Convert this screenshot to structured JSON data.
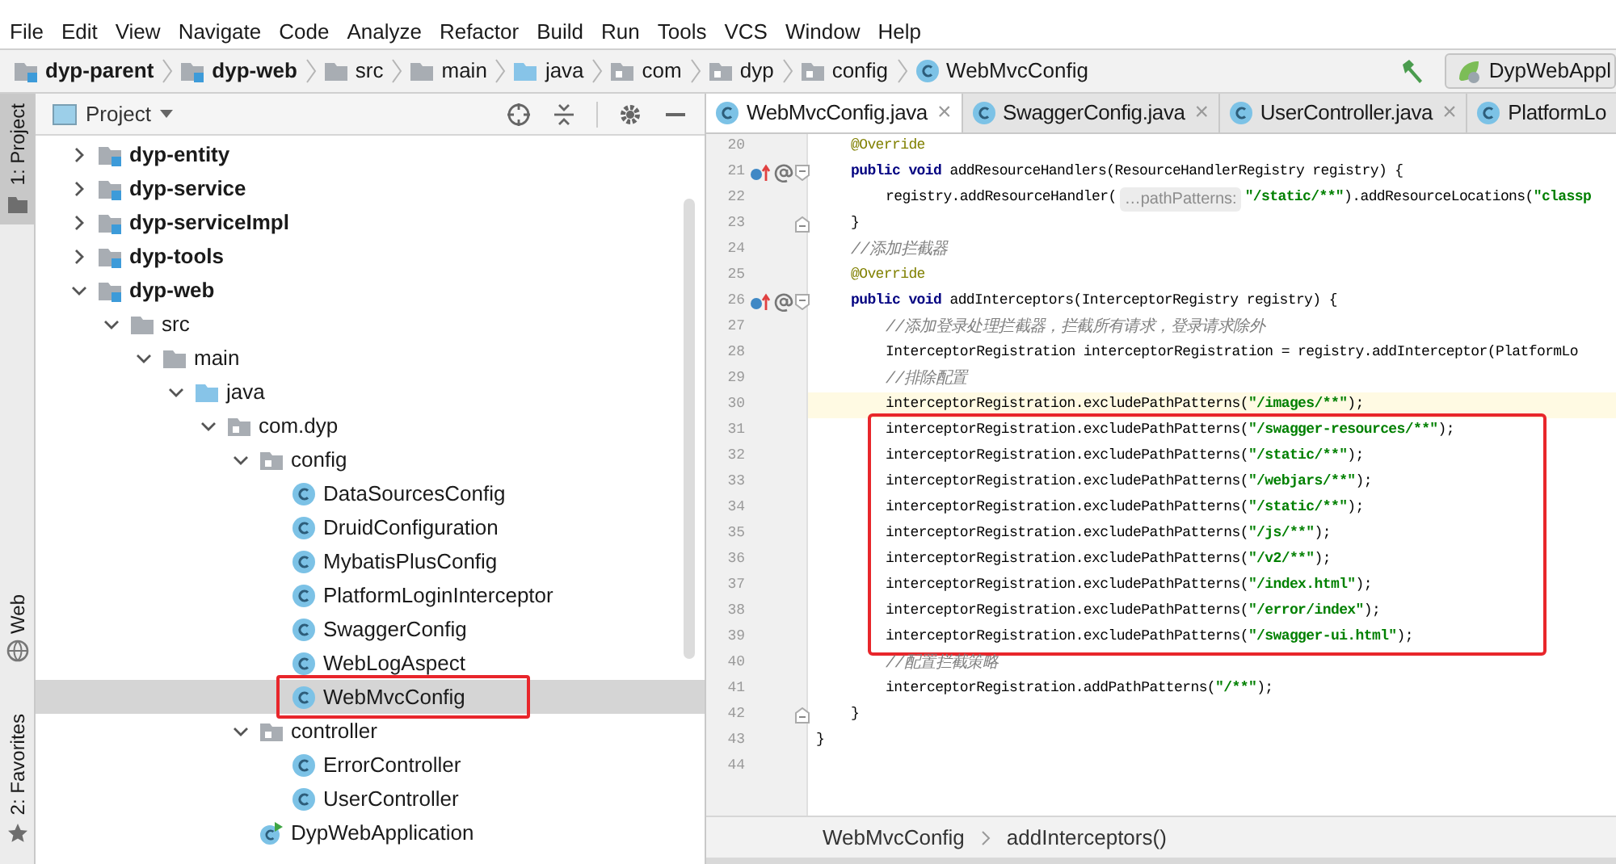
{
  "menu": [
    "File",
    "Edit",
    "View",
    "Navigate",
    "Code",
    "Analyze",
    "Refactor",
    "Build",
    "Run",
    "Tools",
    "VCS",
    "Window",
    "Help"
  ],
  "navbar": {
    "crumbs": [
      {
        "label": "dyp-parent",
        "kind": "module"
      },
      {
        "label": "dyp-web",
        "kind": "module"
      },
      {
        "label": "src",
        "kind": "folder"
      },
      {
        "label": "main",
        "kind": "folder"
      },
      {
        "label": "java",
        "kind": "source"
      },
      {
        "label": "com",
        "kind": "package"
      },
      {
        "label": "dyp",
        "kind": "package"
      },
      {
        "label": "config",
        "kind": "package"
      },
      {
        "label": "WebMvcConfig",
        "kind": "class"
      }
    ],
    "run_config": "DypWebAppl"
  },
  "tool_strip": [
    {
      "label": "1: Project",
      "kind": "folder",
      "selected": true
    },
    {
      "label": "Web",
      "kind": "globe",
      "selected": false
    },
    {
      "label": "2: Favorites",
      "kind": "star",
      "selected": false
    }
  ],
  "project": {
    "title": "Project",
    "tree": [
      {
        "label": "dyp-entity",
        "kind": "module",
        "expanded": false,
        "selected": false,
        "highlighted": false
      },
      {
        "label": "dyp-service",
        "kind": "module",
        "expanded": false,
        "selected": false,
        "highlighted": false
      },
      {
        "label": "dyp-serviceImpl",
        "kind": "module",
        "expanded": false,
        "selected": false,
        "highlighted": false
      },
      {
        "label": "dyp-tools",
        "kind": "module",
        "expanded": false,
        "selected": false,
        "highlighted": false
      },
      {
        "label": "dyp-web",
        "kind": "module",
        "expanded": true,
        "selected": false,
        "highlighted": false,
        "children": [
          {
            "label": "src",
            "kind": "folder",
            "expanded": true,
            "selected": false,
            "highlighted": false,
            "children": [
              {
                "label": "main",
                "kind": "folder",
                "expanded": true,
                "selected": false,
                "highlighted": false,
                "children": [
                  {
                    "label": "java",
                    "kind": "source",
                    "expanded": true,
                    "selected": false,
                    "highlighted": false,
                    "children": [
                      {
                        "label": "com.dyp",
                        "kind": "package",
                        "expanded": true,
                        "selected": false,
                        "highlighted": false,
                        "children": [
                          {
                            "label": "config",
                            "kind": "package",
                            "expanded": true,
                            "selected": false,
                            "highlighted": false,
                            "children": [
                              {
                                "label": "DataSourcesConfig",
                                "kind": "class",
                                "selected": false,
                                "highlighted": false
                              },
                              {
                                "label": "DruidConfiguration",
                                "kind": "class",
                                "selected": false,
                                "highlighted": false
                              },
                              {
                                "label": "MybatisPlusConfig",
                                "kind": "class",
                                "selected": false,
                                "highlighted": false
                              },
                              {
                                "label": "PlatformLoginInterceptor",
                                "kind": "class",
                                "selected": false,
                                "highlighted": false
                              },
                              {
                                "label": "SwaggerConfig",
                                "kind": "class",
                                "selected": false,
                                "highlighted": false
                              },
                              {
                                "label": "WebLogAspect",
                                "kind": "class",
                                "selected": false,
                                "highlighted": false
                              },
                              {
                                "label": "WebMvcConfig",
                                "kind": "class",
                                "selected": true,
                                "highlighted": true
                              }
                            ]
                          },
                          {
                            "label": "controller",
                            "kind": "package",
                            "expanded": true,
                            "selected": false,
                            "highlighted": false,
                            "children": [
                              {
                                "label": "ErrorController",
                                "kind": "class",
                                "selected": false,
                                "highlighted": false
                              },
                              {
                                "label": "UserController",
                                "kind": "class",
                                "selected": false,
                                "highlighted": false
                              }
                            ]
                          },
                          {
                            "label": "DypWebApplication",
                            "kind": "app",
                            "selected": false,
                            "highlighted": false
                          }
                        ]
                      }
                    ]
                  }
                ]
              }
            ]
          }
        ]
      }
    ]
  },
  "editor": {
    "tabs": [
      {
        "label": "WebMvcConfig.java",
        "selected": true,
        "close": "×"
      },
      {
        "label": "SwaggerConfig.java",
        "selected": false,
        "close": "×"
      },
      {
        "label": "UserController.java",
        "selected": false,
        "close": "×"
      },
      {
        "label": "PlatformLo",
        "selected": false
      }
    ],
    "lines": [
      {
        "kind": "line",
        "number": "20",
        "segments": [
          {
            "kind": "annotation",
            "text": "@Override"
          }
        ]
      },
      {
        "kind": "line",
        "number": "21",
        "overrides": true,
        "fold_start": true,
        "segments": [
          {
            "kind": "keyword",
            "text": "public void "
          },
          {
            "kind": "plain",
            "text": "addResourceHandlers(ResourceHandlerRegistry registry) {"
          }
        ]
      },
      {
        "kind": "line",
        "number": "22",
        "segments": [
          {
            "kind": "plain",
            "text": "registry.addResourceHandler("
          },
          {
            "kind": "hint",
            "text": "…pathPatterns:"
          },
          {
            "kind": "string",
            "text": "\"/static/**\""
          },
          {
            "kind": "plain",
            "text": ").addResourceLocations("
          },
          {
            "kind": "string",
            "text": "\"classp"
          }
        ]
      },
      {
        "kind": "line",
        "number": "23",
        "fold_end": true,
        "segments": [
          {
            "kind": "plain",
            "text": "}"
          }
        ]
      },
      {
        "kind": "line",
        "number": "24",
        "segments": [
          {
            "kind": "comment",
            "text": "//添加拦截器"
          }
        ]
      },
      {
        "kind": "line",
        "number": "25",
        "segments": [
          {
            "kind": "annotation",
            "text": "@Override"
          }
        ]
      },
      {
        "kind": "line",
        "number": "26",
        "overrides": true,
        "fold_start": true,
        "segments": [
          {
            "kind": "keyword",
            "text": "public void "
          },
          {
            "kind": "plain",
            "text": "addInterceptors(InterceptorRegistry registry) {"
          }
        ]
      },
      {
        "kind": "line",
        "number": "27",
        "segments": [
          {
            "kind": "comment",
            "text": "//添加登录处理拦截器，拦截所有请求，登录请求除外"
          }
        ]
      },
      {
        "kind": "line",
        "number": "28",
        "segments": [
          {
            "kind": "plain",
            "text": "InterceptorRegistration interceptorRegistration = registry.addInterceptor(PlatformLo"
          }
        ]
      },
      {
        "kind": "line",
        "number": "29",
        "segments": [
          {
            "kind": "comment",
            "text": "//排除配置"
          }
        ]
      },
      {
        "kind": "line",
        "number": "30",
        "current": true,
        "segments": [
          {
            "kind": "plain",
            "text": "interceptorRegistration.excludePathPatterns("
          },
          {
            "kind": "string",
            "text": "\"/images/**\""
          },
          {
            "kind": "plain",
            "text": ");"
          }
        ]
      },
      {
        "kind": "highlight_box",
        "lines": [
          {
            "kind": "line",
            "number": "31",
            "segments": [
              {
                "kind": "plain",
                "text": "interceptorRegistration.excludePathPatterns("
              },
              {
                "kind": "string",
                "text": "\"/swagger-resources/**\""
              },
              {
                "kind": "plain",
                "text": ");"
              }
            ]
          },
          {
            "kind": "line",
            "number": "32",
            "segments": [
              {
                "kind": "plain",
                "text": "interceptorRegistration.excludePathPatterns("
              },
              {
                "kind": "string",
                "text": "\"/static/**\""
              },
              {
                "kind": "plain",
                "text": ");"
              }
            ]
          },
          {
            "kind": "line",
            "number": "33",
            "segments": [
              {
                "kind": "plain",
                "text": "interceptorRegistration.excludePathPatterns("
              },
              {
                "kind": "string",
                "text": "\"/webjars/**\""
              },
              {
                "kind": "plain",
                "text": ");"
              }
            ]
          },
          {
            "kind": "line",
            "number": "34",
            "segments": [
              {
                "kind": "plain",
                "text": "interceptorRegistration.excludePathPatterns("
              },
              {
                "kind": "string",
                "text": "\"/static/**\""
              },
              {
                "kind": "plain",
                "text": ");"
              }
            ]
          },
          {
            "kind": "line",
            "number": "35",
            "segments": [
              {
                "kind": "plain",
                "text": "interceptorRegistration.excludePathPatterns("
              },
              {
                "kind": "string",
                "text": "\"/js/**\""
              },
              {
                "kind": "plain",
                "text": ");"
              }
            ]
          },
          {
            "kind": "line",
            "number": "36",
            "segments": [
              {
                "kind": "plain",
                "text": "interceptorRegistration.excludePathPatterns("
              },
              {
                "kind": "string",
                "text": "\"/v2/**\""
              },
              {
                "kind": "plain",
                "text": ");"
              }
            ]
          },
          {
            "kind": "line",
            "number": "37",
            "segments": [
              {
                "kind": "plain",
                "text": "interceptorRegistration.excludePathPatterns("
              },
              {
                "kind": "string",
                "text": "\"/index.html\""
              },
              {
                "kind": "plain",
                "text": ");"
              }
            ]
          },
          {
            "kind": "line",
            "number": "38",
            "segments": [
              {
                "kind": "plain",
                "text": "interceptorRegistration.excludePathPatterns("
              },
              {
                "kind": "string",
                "text": "\"/error/index\""
              },
              {
                "kind": "plain",
                "text": ");"
              }
            ]
          },
          {
            "kind": "line",
            "number": "39",
            "segments": [
              {
                "kind": "plain",
                "text": "interceptorRegistration.excludePathPatterns("
              },
              {
                "kind": "string",
                "text": "\"/swagger-ui.html\""
              },
              {
                "kind": "plain",
                "text": ");"
              }
            ]
          }
        ]
      },
      {
        "kind": "line",
        "number": "40",
        "segments": [
          {
            "kind": "comment",
            "text": "//配置拦截策略"
          }
        ]
      },
      {
        "kind": "line",
        "number": "41",
        "segments": [
          {
            "kind": "plain",
            "text": "interceptorRegistration.addPathPatterns("
          },
          {
            "kind": "string",
            "text": "\"/**\""
          },
          {
            "kind": "plain",
            "text": ");"
          }
        ]
      },
      {
        "kind": "line",
        "number": "42",
        "fold_end": true,
        "segments": [
          {
            "kind": "plain",
            "text": "}"
          }
        ]
      },
      {
        "kind": "line",
        "number": "43",
        "segments": [
          {
            "kind": "plain",
            "text": "}"
          }
        ]
      },
      {
        "kind": "line",
        "number": "44"
      }
    ],
    "breadcrumb": [
      "WebMvcConfig",
      "addInterceptors()"
    ]
  }
}
